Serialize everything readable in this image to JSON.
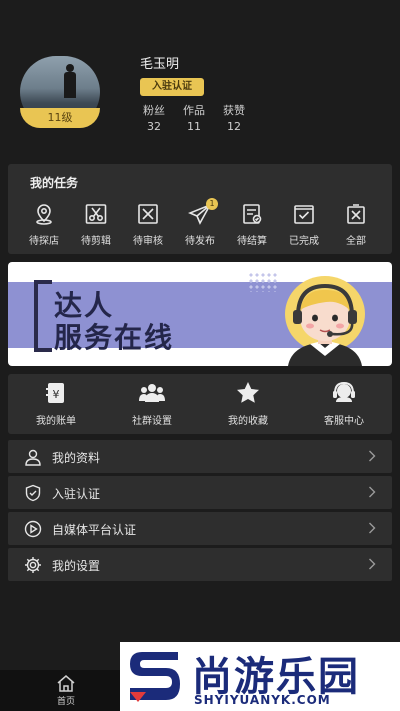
{
  "profile": {
    "username": "毛玉明",
    "level": "11级",
    "verify_label": "入驻认证",
    "stats": [
      {
        "label": "粉丝",
        "value": "32"
      },
      {
        "label": "作品",
        "value": "11"
      },
      {
        "label": "获赞",
        "value": "12"
      }
    ]
  },
  "tasks": {
    "title": "我的任务",
    "items": [
      {
        "label": "待探店",
        "icon": "location-pin-icon"
      },
      {
        "label": "待剪辑",
        "icon": "scissors-icon"
      },
      {
        "label": "待审核",
        "icon": "review-box-icon"
      },
      {
        "label": "待发布",
        "icon": "paper-plane-icon",
        "badge": "1"
      },
      {
        "label": "待结算",
        "icon": "invoice-icon"
      },
      {
        "label": "已完成",
        "icon": "check-box-icon"
      },
      {
        "label": "全部",
        "icon": "all-box-icon"
      }
    ]
  },
  "banner": {
    "line1": "达人",
    "line2": "服务在线"
  },
  "quick_menu": [
    {
      "label": "我的账单",
      "icon": "bill-icon"
    },
    {
      "label": "社群设置",
      "icon": "group-icon"
    },
    {
      "label": "我的收藏",
      "icon": "star-icon"
    },
    {
      "label": "客服中心",
      "icon": "headset-icon"
    }
  ],
  "settings_list": [
    {
      "label": "我的资料",
      "icon": "user-icon"
    },
    {
      "label": "入驻认证",
      "icon": "shield-check-icon"
    },
    {
      "label": "自媒体平台认证",
      "icon": "play-circle-icon"
    },
    {
      "label": "我的设置",
      "icon": "gear-icon"
    }
  ],
  "bottom_nav": {
    "home_label": "首页"
  },
  "watermark": {
    "title": "尚游乐园",
    "subtitle": "SHYIYUANYK.COM"
  },
  "colors": {
    "background": "#1c1c1c",
    "card": "#2e2e2e",
    "accent_gold": "#e9c553",
    "banner_purple": "#8e91d2",
    "watermark_blue": "#1b2b7a"
  }
}
